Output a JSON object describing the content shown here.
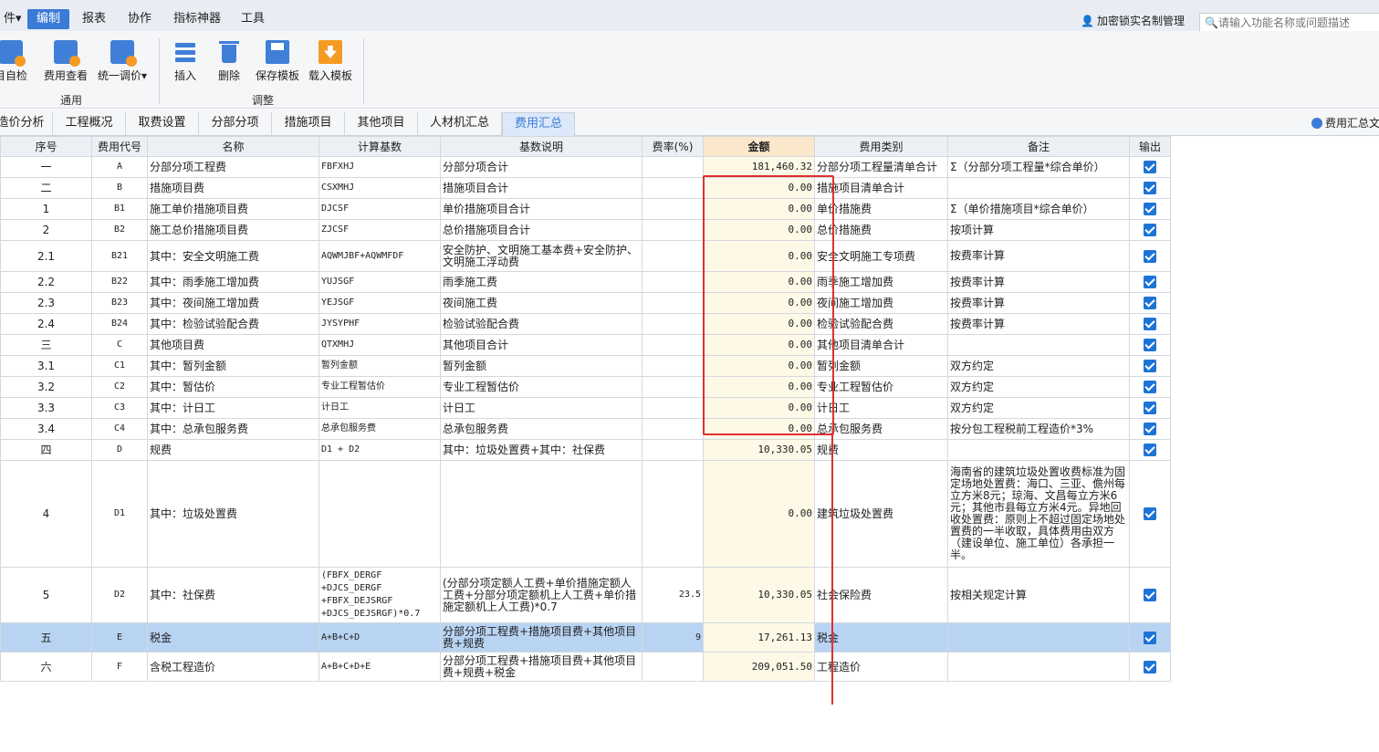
{
  "menubar": {
    "items": [
      {
        "label": "件▾"
      },
      {
        "label": "编制"
      },
      {
        "label": "报表"
      },
      {
        "label": "协作"
      },
      {
        "label": "指标神器"
      },
      {
        "label": "工具"
      }
    ],
    "lock_label": "加密锁实名制管理",
    "search_placeholder": "请输入功能名称或问题描述"
  },
  "ribbon": {
    "buttons": [
      {
        "label": "目自检",
        "icon": "check-doc-icon"
      },
      {
        "label": "费用查看",
        "icon": "view-cost-icon"
      },
      {
        "label": "统一调价▾",
        "icon": "adjust-price-icon"
      },
      {
        "label": "插入",
        "icon": "insert-icon"
      },
      {
        "label": "删除",
        "icon": "delete-icon"
      },
      {
        "label": "保存模板",
        "icon": "save-template-icon"
      },
      {
        "label": "载入模板",
        "icon": "load-template-icon"
      }
    ],
    "groups": [
      "通用",
      "调整"
    ]
  },
  "tabs": [
    {
      "label": "造价分析"
    },
    {
      "label": "工程概况"
    },
    {
      "label": "取费设置"
    },
    {
      "label": "分部分项"
    },
    {
      "label": "措施项目"
    },
    {
      "label": "其他项目"
    },
    {
      "label": "人材机汇总"
    },
    {
      "label": "费用汇总"
    }
  ],
  "summary_link": "费用汇总文",
  "table": {
    "headers": [
      "序号",
      "费用代号",
      "名称",
      "计算基数",
      "基数说明",
      "费率(%)",
      "金额",
      "费用类别",
      "备注",
      "输出"
    ],
    "rows": [
      {
        "seq": "一",
        "code": "A",
        "name": "分部分项工程费",
        "base": "FBFXHJ",
        "desc": "分部分项合计",
        "rate": "",
        "amount": "181,460.32",
        "category": "分部分项工程量清单合计",
        "note": "Σ（分部分项工程量*综合单价）"
      },
      {
        "seq": "二",
        "code": "B",
        "name": "措施项目费",
        "base": "CSXMHJ",
        "desc": "措施项目合计",
        "rate": "",
        "amount": "0.00",
        "category": "措施项目清单合计",
        "note": ""
      },
      {
        "seq": "1",
        "code": "B1",
        "name": "施工单价措施项目费",
        "base": "DJCSF",
        "desc": "单价措施项目合计",
        "rate": "",
        "amount": "0.00",
        "category": "单价措施费",
        "note": "Σ（单价措施项目*综合单价）"
      },
      {
        "seq": "2",
        "code": "B2",
        "name": "施工总价措施项目费",
        "base": "ZJCSF",
        "desc": "总价措施项目合计",
        "rate": "",
        "amount": "0.00",
        "category": "总价措施费",
        "note": "按项计算"
      },
      {
        "seq": "2.1",
        "code": "B21",
        "name": "其中：安全文明施工费",
        "base": "AQWMJBF+AQWMFDF",
        "desc": "安全防护、文明施工基本费+安全防护、文明施工浮动费",
        "rate": "",
        "amount": "0.00",
        "category": "安全文明施工专项费",
        "note": "按费率计算"
      },
      {
        "seq": "2.2",
        "code": "B22",
        "name": "其中：雨季施工增加费",
        "base": "YUJSGF",
        "desc": "雨季施工费",
        "rate": "",
        "amount": "0.00",
        "category": "雨季施工增加费",
        "note": "按费率计算"
      },
      {
        "seq": "2.3",
        "code": "B23",
        "name": "其中：夜间施工增加费",
        "base": "YEJSGF",
        "desc": "夜间施工费",
        "rate": "",
        "amount": "0.00",
        "category": "夜间施工增加费",
        "note": "按费率计算"
      },
      {
        "seq": "2.4",
        "code": "B24",
        "name": "其中：检验试验配合费",
        "base": "JYSYPHF",
        "desc": "检验试验配合费",
        "rate": "",
        "amount": "0.00",
        "category": "检验试验配合费",
        "note": "按费率计算"
      },
      {
        "seq": "三",
        "code": "C",
        "name": "其他项目费",
        "base": "QTXMHJ",
        "desc": "其他项目合计",
        "rate": "",
        "amount": "0.00",
        "category": "其他项目清单合计",
        "note": ""
      },
      {
        "seq": "3.1",
        "code": "C1",
        "name": "其中：暂列金额",
        "base": "暂列金额",
        "desc": "暂列金额",
        "rate": "",
        "amount": "0.00",
        "category": "暂列金额",
        "note": "双方约定"
      },
      {
        "seq": "3.2",
        "code": "C2",
        "name": "其中：暂估价",
        "base": "专业工程暂估价",
        "desc": "专业工程暂估价",
        "rate": "",
        "amount": "0.00",
        "category": "专业工程暂估价",
        "note": "双方约定"
      },
      {
        "seq": "3.3",
        "code": "C3",
        "name": "其中：计日工",
        "base": "计日工",
        "desc": "计日工",
        "rate": "",
        "amount": "0.00",
        "category": "计日工",
        "note": "双方约定"
      },
      {
        "seq": "3.4",
        "code": "C4",
        "name": "其中：总承包服务费",
        "base": "总承包服务费",
        "desc": "总承包服务费",
        "rate": "",
        "amount": "0.00",
        "category": "总承包服务费",
        "note": "按分包工程税前工程造价*3%"
      },
      {
        "seq": "四",
        "code": "D",
        "name": "规费",
        "base": "D1 + D2",
        "desc": "其中：垃圾处置费+其中：社保费",
        "rate": "",
        "amount": "10,330.05",
        "category": "规费",
        "note": ""
      },
      {
        "seq": "4",
        "code": "D1",
        "name": "其中：垃圾处置费",
        "base": "",
        "desc": "",
        "rate": "",
        "amount": "0.00",
        "category": "建筑垃圾处置费",
        "note": "海南省的建筑垃圾处置收费标准为固定场地处置费：海口、三亚、儋州每立方米8元；琼海、文昌每立方米6元；其他市县每立方米4元。异地回收处置费：原则上不超过固定场地处置费的一半收取，具体费用由双方（建设单位、施工单位）各承担一半。"
      },
      {
        "seq": "5",
        "code": "D2",
        "name": "其中：社保费",
        "base": "(FBFX_DERGF +DJCS_DERGF +FBFX_DEJSRGF +DJCS_DEJSRGF)*0.7",
        "desc": "(分部分项定额人工费+单价措施定额人工费+分部分项定额机上人工费+单价措施定额机上人工费)*0.7",
        "rate": "23.5",
        "amount": "10,330.05",
        "category": "社会保险费",
        "note": "按相关规定计算"
      },
      {
        "seq": "五",
        "code": "E",
        "name": "税金",
        "base": "A+B+C+D",
        "desc": "分部分项工程费+措施项目费+其他项目费+规费",
        "rate": "9",
        "amount": "17,261.13",
        "category": "税金",
        "note": ""
      },
      {
        "seq": "六",
        "code": "F",
        "name": "含税工程造价",
        "base": "A+B+C+D+E",
        "desc": "分部分项工程费+措施项目费+其他项目费+规费+税金",
        "rate": "",
        "amount": "209,051.50",
        "category": "工程造价",
        "note": ""
      }
    ]
  },
  "colors": {
    "accent": "#3a7bd5",
    "selected_row": "#b9d4f3",
    "amount_column": "#fdf9e6",
    "annotation": "#e03030"
  }
}
